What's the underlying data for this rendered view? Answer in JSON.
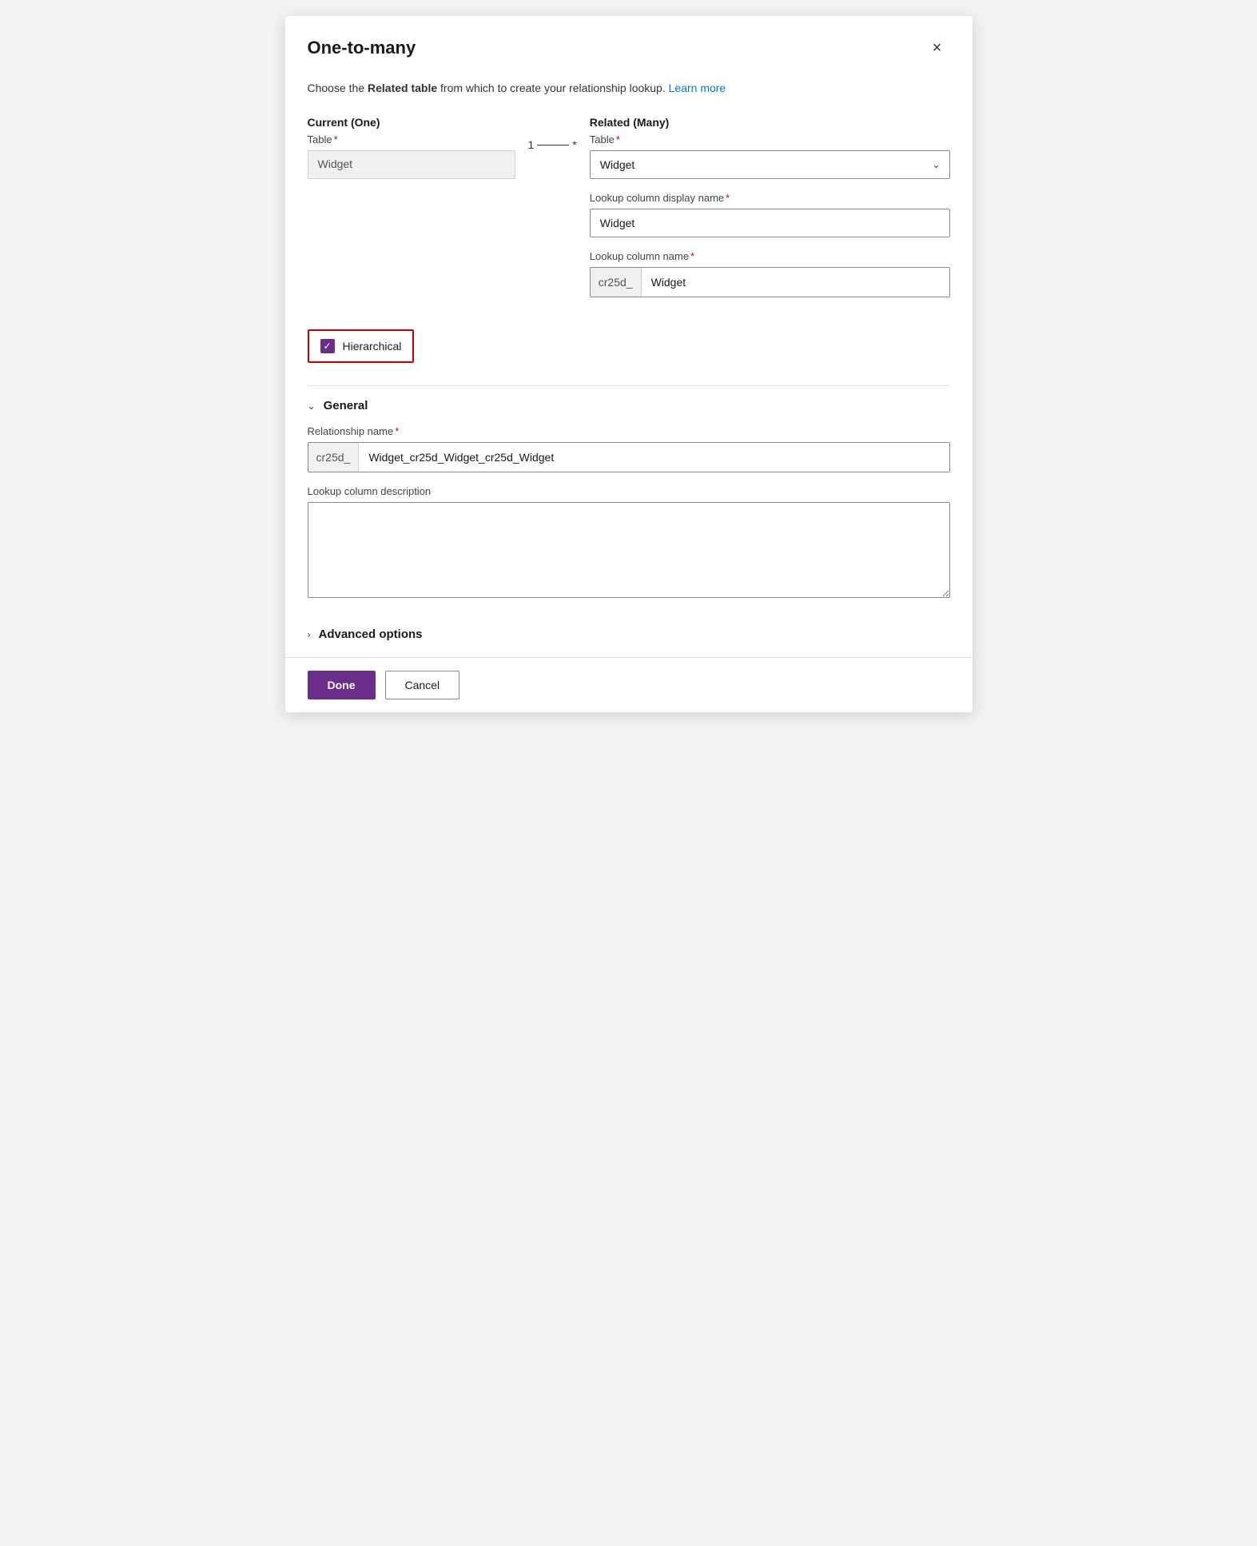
{
  "dialog": {
    "title": "One-to-many",
    "close_label": "×"
  },
  "description": {
    "text_before": "Choose the ",
    "bold_text": "Related table",
    "text_after": " from which to create your relationship lookup. ",
    "link_text": "Learn more",
    "link_href": "#"
  },
  "current_section": {
    "label": "Current (One)",
    "field_label": "Table",
    "required": true,
    "value": "Widget"
  },
  "connector": {
    "one": "1",
    "many": "*"
  },
  "related_section": {
    "label": "Related (Many)",
    "table_field": {
      "label": "Table",
      "required": true,
      "selected_value": "Widget",
      "options": [
        "Widget"
      ]
    },
    "lookup_display_name_field": {
      "label": "Lookup column display name",
      "required": true,
      "value": "Widget"
    },
    "lookup_column_name_field": {
      "label": "Lookup column name",
      "required": true,
      "prefix": "cr25d_",
      "value": "Widget"
    }
  },
  "hierarchical": {
    "label": "Hierarchical",
    "checked": true
  },
  "general_section": {
    "label": "General",
    "collapsed": false,
    "relationship_name_field": {
      "label": "Relationship name",
      "required": true,
      "prefix": "cr25d_",
      "value": "Widget_cr25d_Widget_cr25d_Widget"
    },
    "lookup_description_field": {
      "label": "Lookup column description",
      "value": ""
    }
  },
  "advanced_section": {
    "label": "Advanced options",
    "collapsed": true
  },
  "footer": {
    "done_label": "Done",
    "cancel_label": "Cancel"
  }
}
